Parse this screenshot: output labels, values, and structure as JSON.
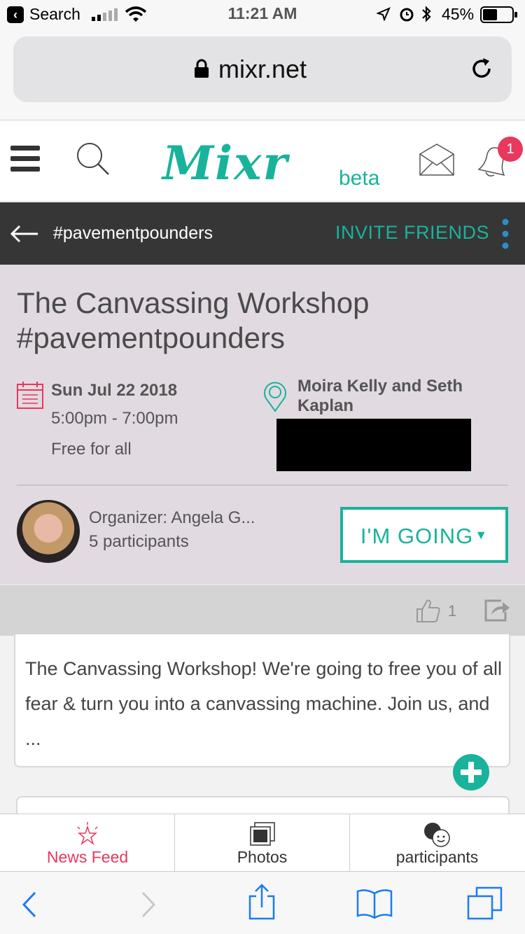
{
  "status_bar": {
    "back_app": "Search",
    "time": "11:21 AM",
    "battery": "45%"
  },
  "browser": {
    "url": "mixr.net"
  },
  "app_header": {
    "logo": "Mixr",
    "beta": "beta",
    "notification_count": "1"
  },
  "group_bar": {
    "tag": "#pavementpounders",
    "invite": "INVITE FRIENDS"
  },
  "event": {
    "title": "The Canvassing Workshop #pavementpounders",
    "date": "Sun Jul 22 2018",
    "time": "5:00pm - 7:00pm",
    "price": "Free for all",
    "location": "Moira Kelly and Seth Kaplan",
    "organizer": "Organizer: Angela G...",
    "participants": "5 participants",
    "going_button": "I'M GOING"
  },
  "actions": {
    "like_count": "1"
  },
  "description": "The Canvassing Workshop!  We're going to free you of all fear & turn you into a canvassing machine. Join us, and ...",
  "tabs": [
    {
      "label": "News Feed",
      "icon": "star-icon",
      "active": true
    },
    {
      "label": "Photos",
      "icon": "photos-icon",
      "active": false
    },
    {
      "label": "participants",
      "icon": "participants-icon",
      "active": false
    }
  ],
  "colors": {
    "accent": "#19b39b",
    "dark_nav": "#363636",
    "event_bg": "#e1dae1",
    "alert": "#e8385e"
  }
}
